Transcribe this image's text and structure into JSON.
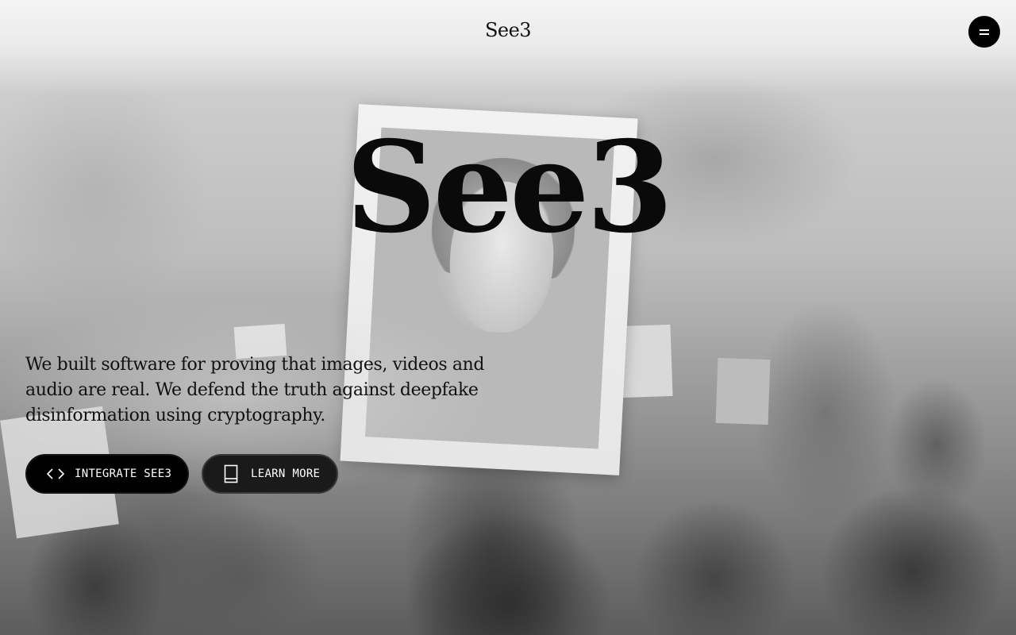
{
  "header": {
    "brand": "See3",
    "menu_icon": "hamburger-icon"
  },
  "hero": {
    "title": "See3",
    "tagline": "We built software for proving that images, videos and audio are real. We defend the truth against deepfake disinformation using cryptography.",
    "buttons": [
      {
        "label": "INTEGRATE SEE3",
        "icon": "code-brackets-icon"
      },
      {
        "label": "LEARN MORE",
        "icon": "book-icon"
      }
    ]
  },
  "colors": {
    "text": "#111111",
    "button_bg": "#000000",
    "button_text": "#ffffff"
  }
}
